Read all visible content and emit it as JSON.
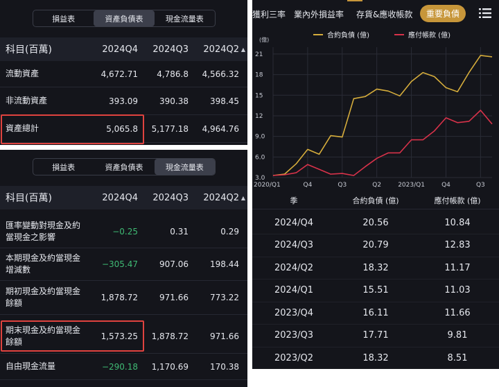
{
  "balance_sheet": {
    "tabs": [
      "損益表",
      "資產負債表",
      "現金流量表"
    ],
    "active_tab": 1,
    "header": {
      "label": "科目(百萬)",
      "cols": [
        "2024Q4",
        "2024Q3",
        "2024Q2"
      ]
    },
    "rows": [
      {
        "label": "流動資產",
        "values": [
          "4,672.71",
          "4,786.8",
          "4,566.32"
        ]
      },
      {
        "label": "非流動資產",
        "values": [
          "393.09",
          "390.38",
          "398.45"
        ]
      },
      {
        "label": "資產總計",
        "values": [
          "5,065.8",
          "5,177.18",
          "4,964.76"
        ]
      }
    ]
  },
  "cash_flow": {
    "tabs": [
      "損益表",
      "資產負債表",
      "現金流量表"
    ],
    "active_tab": 2,
    "header": {
      "label": "科目(百萬)",
      "cols": [
        "2024Q4",
        "2024Q3",
        "2024Q2"
      ]
    },
    "rows": [
      {
        "label": "匯率變動對現金及約當現金之影響",
        "values": [
          "−0.25",
          "0.31",
          "0.29"
        ],
        "neg": true
      },
      {
        "label": "本期現金及約當現金增減數",
        "values": [
          "−305.47",
          "907.06",
          "198.44"
        ],
        "neg": true
      },
      {
        "label": "期初現金及約當現金餘額",
        "values": [
          "1,878.72",
          "971.66",
          "773.22"
        ],
        "neg": false
      },
      {
        "label": "期末現金及約當現金餘額",
        "values": [
          "1,573.25",
          "1,878.72",
          "971.66"
        ],
        "neg": false
      },
      {
        "label": "自由現金流量",
        "values": [
          "−290.18",
          "1,170.69",
          "170.38"
        ],
        "neg": true
      }
    ]
  },
  "right_panel": {
    "nav": [
      "獲利三率",
      "業內外損益率",
      "存貨&應收帳款",
      "重要負債"
    ],
    "active_nav": 3,
    "menu_icon": "list-menu-icon",
    "table": {
      "headers": [
        "季",
        "合約負債 (億)",
        "應付帳款 (億)"
      ],
      "rows": [
        [
          "2024/Q4",
          "20.56",
          "10.84"
        ],
        [
          "2024/Q3",
          "20.79",
          "12.83"
        ],
        [
          "2024/Q2",
          "18.32",
          "11.17"
        ],
        [
          "2024/Q1",
          "15.51",
          "11.03"
        ],
        [
          "2023/Q4",
          "16.11",
          "11.66"
        ],
        [
          "2023/Q3",
          "17.71",
          "9.81"
        ],
        [
          "2023/Q2",
          "18.32",
          "8.51"
        ]
      ]
    }
  },
  "colors": {
    "gold": "#d6ad3c",
    "red": "#d8324a",
    "green": "#3fba74",
    "highlight": "#e0433f"
  },
  "chart_data": {
    "type": "line",
    "unit_label": "(億)",
    "ylim": [
      3,
      22
    ],
    "yticks": [
      "3.0",
      "6.0",
      "9.0",
      "12",
      "15",
      "18",
      "21"
    ],
    "ytick_values": [
      3,
      6,
      9,
      12,
      15,
      18,
      21
    ],
    "xtick_labels": [
      "2020/Q1",
      "Q4",
      "Q3",
      "Q2",
      "2023/Q1",
      "Q4",
      "Q3"
    ],
    "xtick_index": [
      0,
      3,
      6,
      9,
      12,
      15,
      18
    ],
    "x": [
      "2020/Q1",
      "2020/Q2",
      "2020/Q3",
      "2020/Q4",
      "2021/Q1",
      "2021/Q2",
      "2021/Q3",
      "2021/Q4",
      "2022/Q1",
      "2022/Q2",
      "2022/Q3",
      "2022/Q4",
      "2023/Q1",
      "2023/Q2",
      "2023/Q3",
      "2023/Q4",
      "2024/Q1",
      "2024/Q2",
      "2024/Q3",
      "2024/Q4"
    ],
    "series": [
      {
        "name": "合約負債 (億)",
        "color": "#d6ad3c",
        "values": [
          3.3,
          3.5,
          5.0,
          7.1,
          6.4,
          9.1,
          8.9,
          14.5,
          14.8,
          15.9,
          15.6,
          14.9,
          17.0,
          18.3,
          17.7,
          16.1,
          15.5,
          18.3,
          20.8,
          20.6
        ]
      },
      {
        "name": "應付帳款 (億)",
        "color": "#d8324a",
        "values": [
          3.3,
          3.4,
          3.7,
          4.9,
          4.2,
          3.5,
          3.6,
          3.3,
          4.6,
          5.8,
          6.6,
          6.6,
          8.5,
          8.5,
          9.8,
          11.7,
          11.0,
          11.2,
          12.8,
          10.8
        ]
      }
    ],
    "grid": true,
    "legend": "top"
  }
}
